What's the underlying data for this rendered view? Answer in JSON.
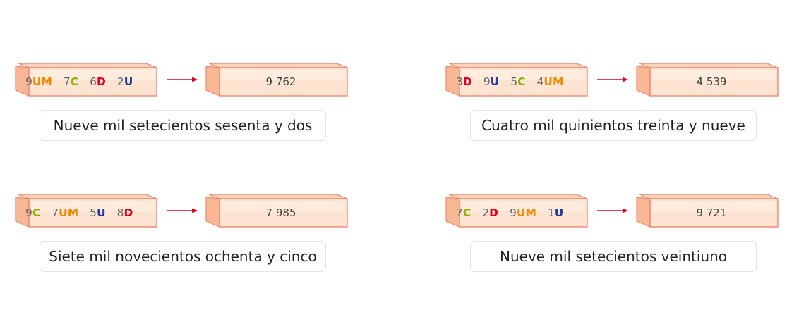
{
  "colors": {
    "UM": "#f28a00",
    "C": "#8cb400",
    "D": "#e3001b",
    "U": "#1f3d9a",
    "block_face": "#fde4d2",
    "block_edge": "#f0856a",
    "arrow": "#e3001b"
  },
  "items": [
    {
      "terms": [
        {
          "coef": "9",
          "unit": "UM"
        },
        {
          "coef": "7",
          "unit": "C"
        },
        {
          "coef": "6",
          "unit": "D"
        },
        {
          "coef": "2",
          "unit": "U"
        }
      ],
      "number": "9 762",
      "words": "Nueve mil setecientos sesenta y dos"
    },
    {
      "terms": [
        {
          "coef": "3",
          "unit": "D"
        },
        {
          "coef": "9",
          "unit": "U"
        },
        {
          "coef": "5",
          "unit": "C"
        },
        {
          "coef": "4",
          "unit": "UM"
        }
      ],
      "number": "4 539",
      "words": "Cuatro mil quinientos treinta y nueve"
    },
    {
      "terms": [
        {
          "coef": "9",
          "unit": "C"
        },
        {
          "coef": "7",
          "unit": "UM"
        },
        {
          "coef": "5",
          "unit": "U"
        },
        {
          "coef": "8",
          "unit": "D"
        }
      ],
      "number": "7 985",
      "words": "Siete mil novecientos ochenta y cinco"
    },
    {
      "terms": [
        {
          "coef": "7",
          "unit": "C"
        },
        {
          "coef": "2",
          "unit": "D"
        },
        {
          "coef": "9",
          "unit": "UM"
        },
        {
          "coef": "1",
          "unit": "U"
        }
      ],
      "number": "9 721",
      "words": "Nueve mil setecientos veintiuno"
    }
  ]
}
